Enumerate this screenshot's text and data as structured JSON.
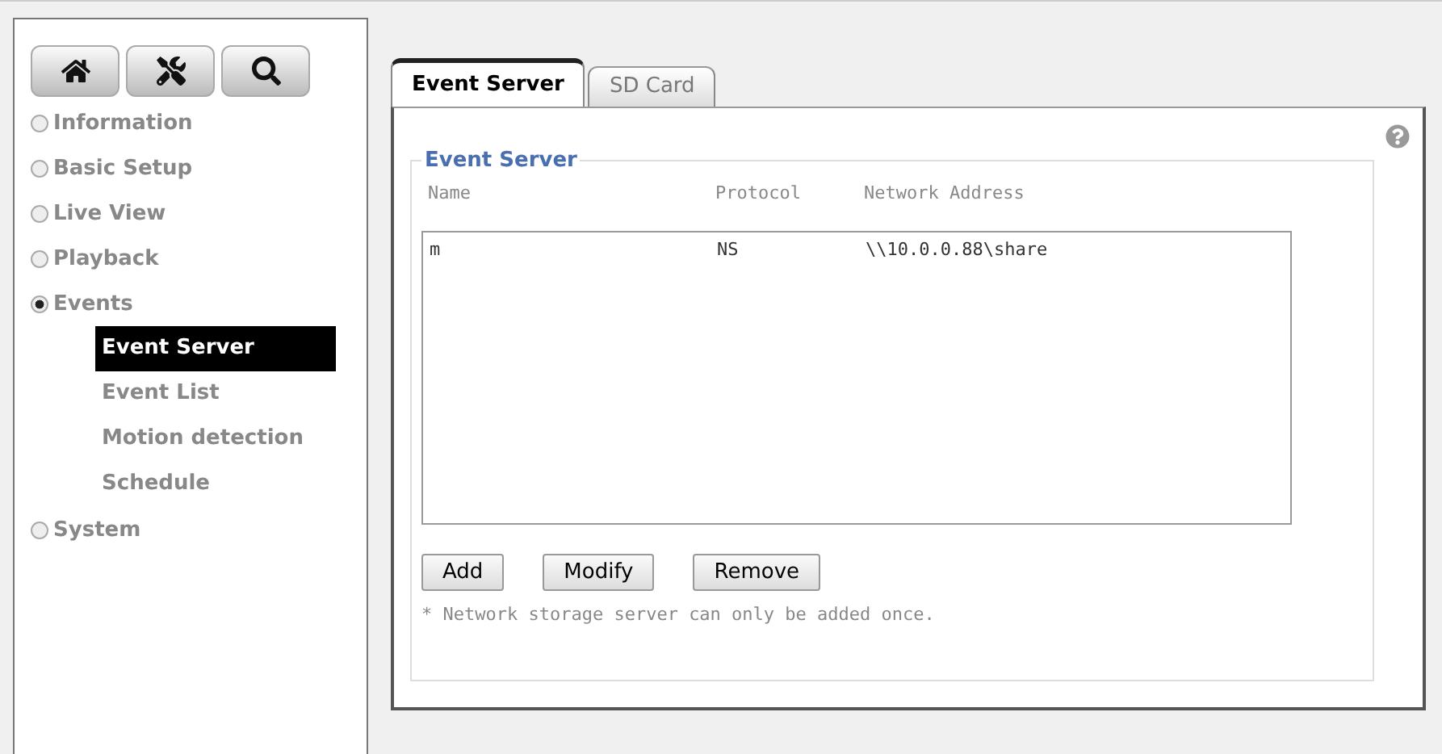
{
  "sidebar": {
    "nav": [
      {
        "label": "Information",
        "selected": false
      },
      {
        "label": "Basic Setup",
        "selected": false
      },
      {
        "label": "Live View",
        "selected": false
      },
      {
        "label": "Playback",
        "selected": false
      },
      {
        "label": "Events",
        "selected": true,
        "children": [
          {
            "label": "Event Server",
            "selected": true
          },
          {
            "label": "Event List",
            "selected": false
          },
          {
            "label": "Motion detection",
            "selected": false
          },
          {
            "label": "Schedule",
            "selected": false
          }
        ]
      },
      {
        "label": "System",
        "selected": false
      }
    ]
  },
  "tabs": [
    {
      "label": "Event Server",
      "selected": true
    },
    {
      "label": "SD Card",
      "selected": false
    }
  ],
  "group": {
    "legend": "Event Server",
    "columns": [
      "Name",
      "Protocol",
      "Network Address"
    ],
    "rows": [
      {
        "cells": [
          "m",
          "NS",
          "\\\\10.0.0.88\\share"
        ],
        "selected": false
      }
    ],
    "buttons": [
      "Add",
      "Modify",
      "Remove"
    ],
    "note": "* Network storage server can only be added once."
  }
}
